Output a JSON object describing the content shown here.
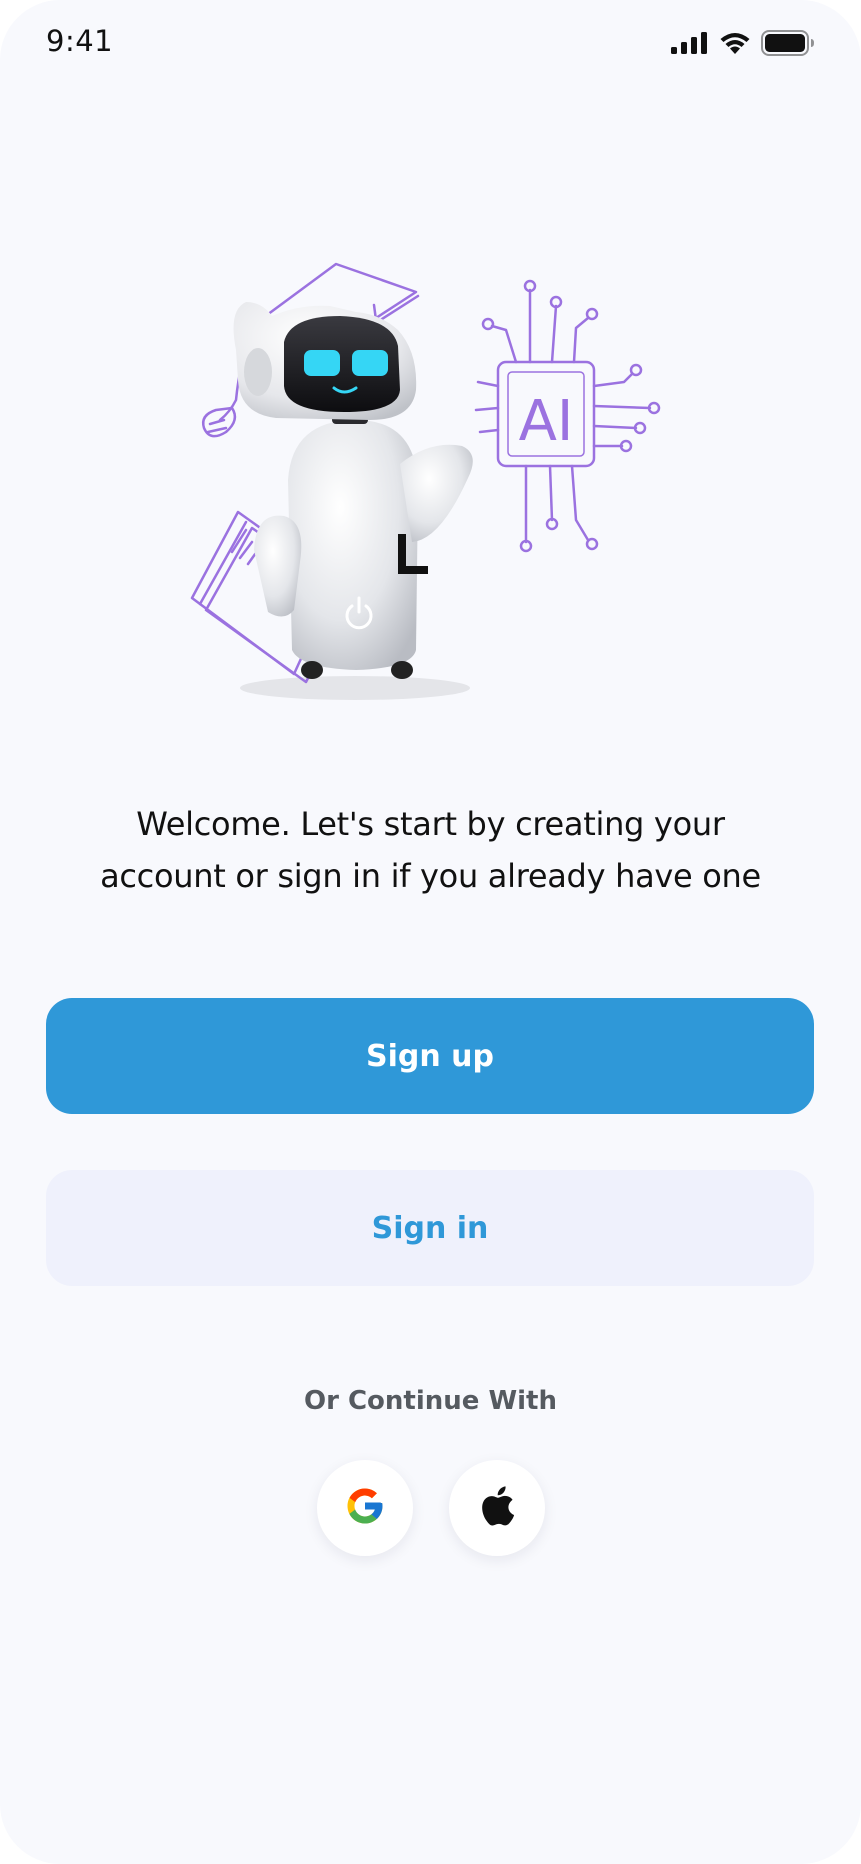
{
  "status_bar": {
    "time": "9:41",
    "icons": [
      "signal-icon",
      "wifi-icon",
      "battery-icon"
    ]
  },
  "hero": {
    "illustration": "robot-graduate-ai-chip-illustration",
    "chip_text": "AI"
  },
  "welcome": {
    "line1": "Welcome. Let's start by creating your",
    "line2": "account or sign in if you already have one"
  },
  "buttons": {
    "sign_up": "Sign up",
    "sign_in": "Sign in"
  },
  "social": {
    "heading": "Or Continue With",
    "providers": [
      "google-icon",
      "apple-icon"
    ]
  },
  "colors": {
    "primary": "#2f98d8",
    "secondary_bg": "#eff1fc",
    "background": "#f8f9fd",
    "illustration_accent": "#9b72e0"
  }
}
